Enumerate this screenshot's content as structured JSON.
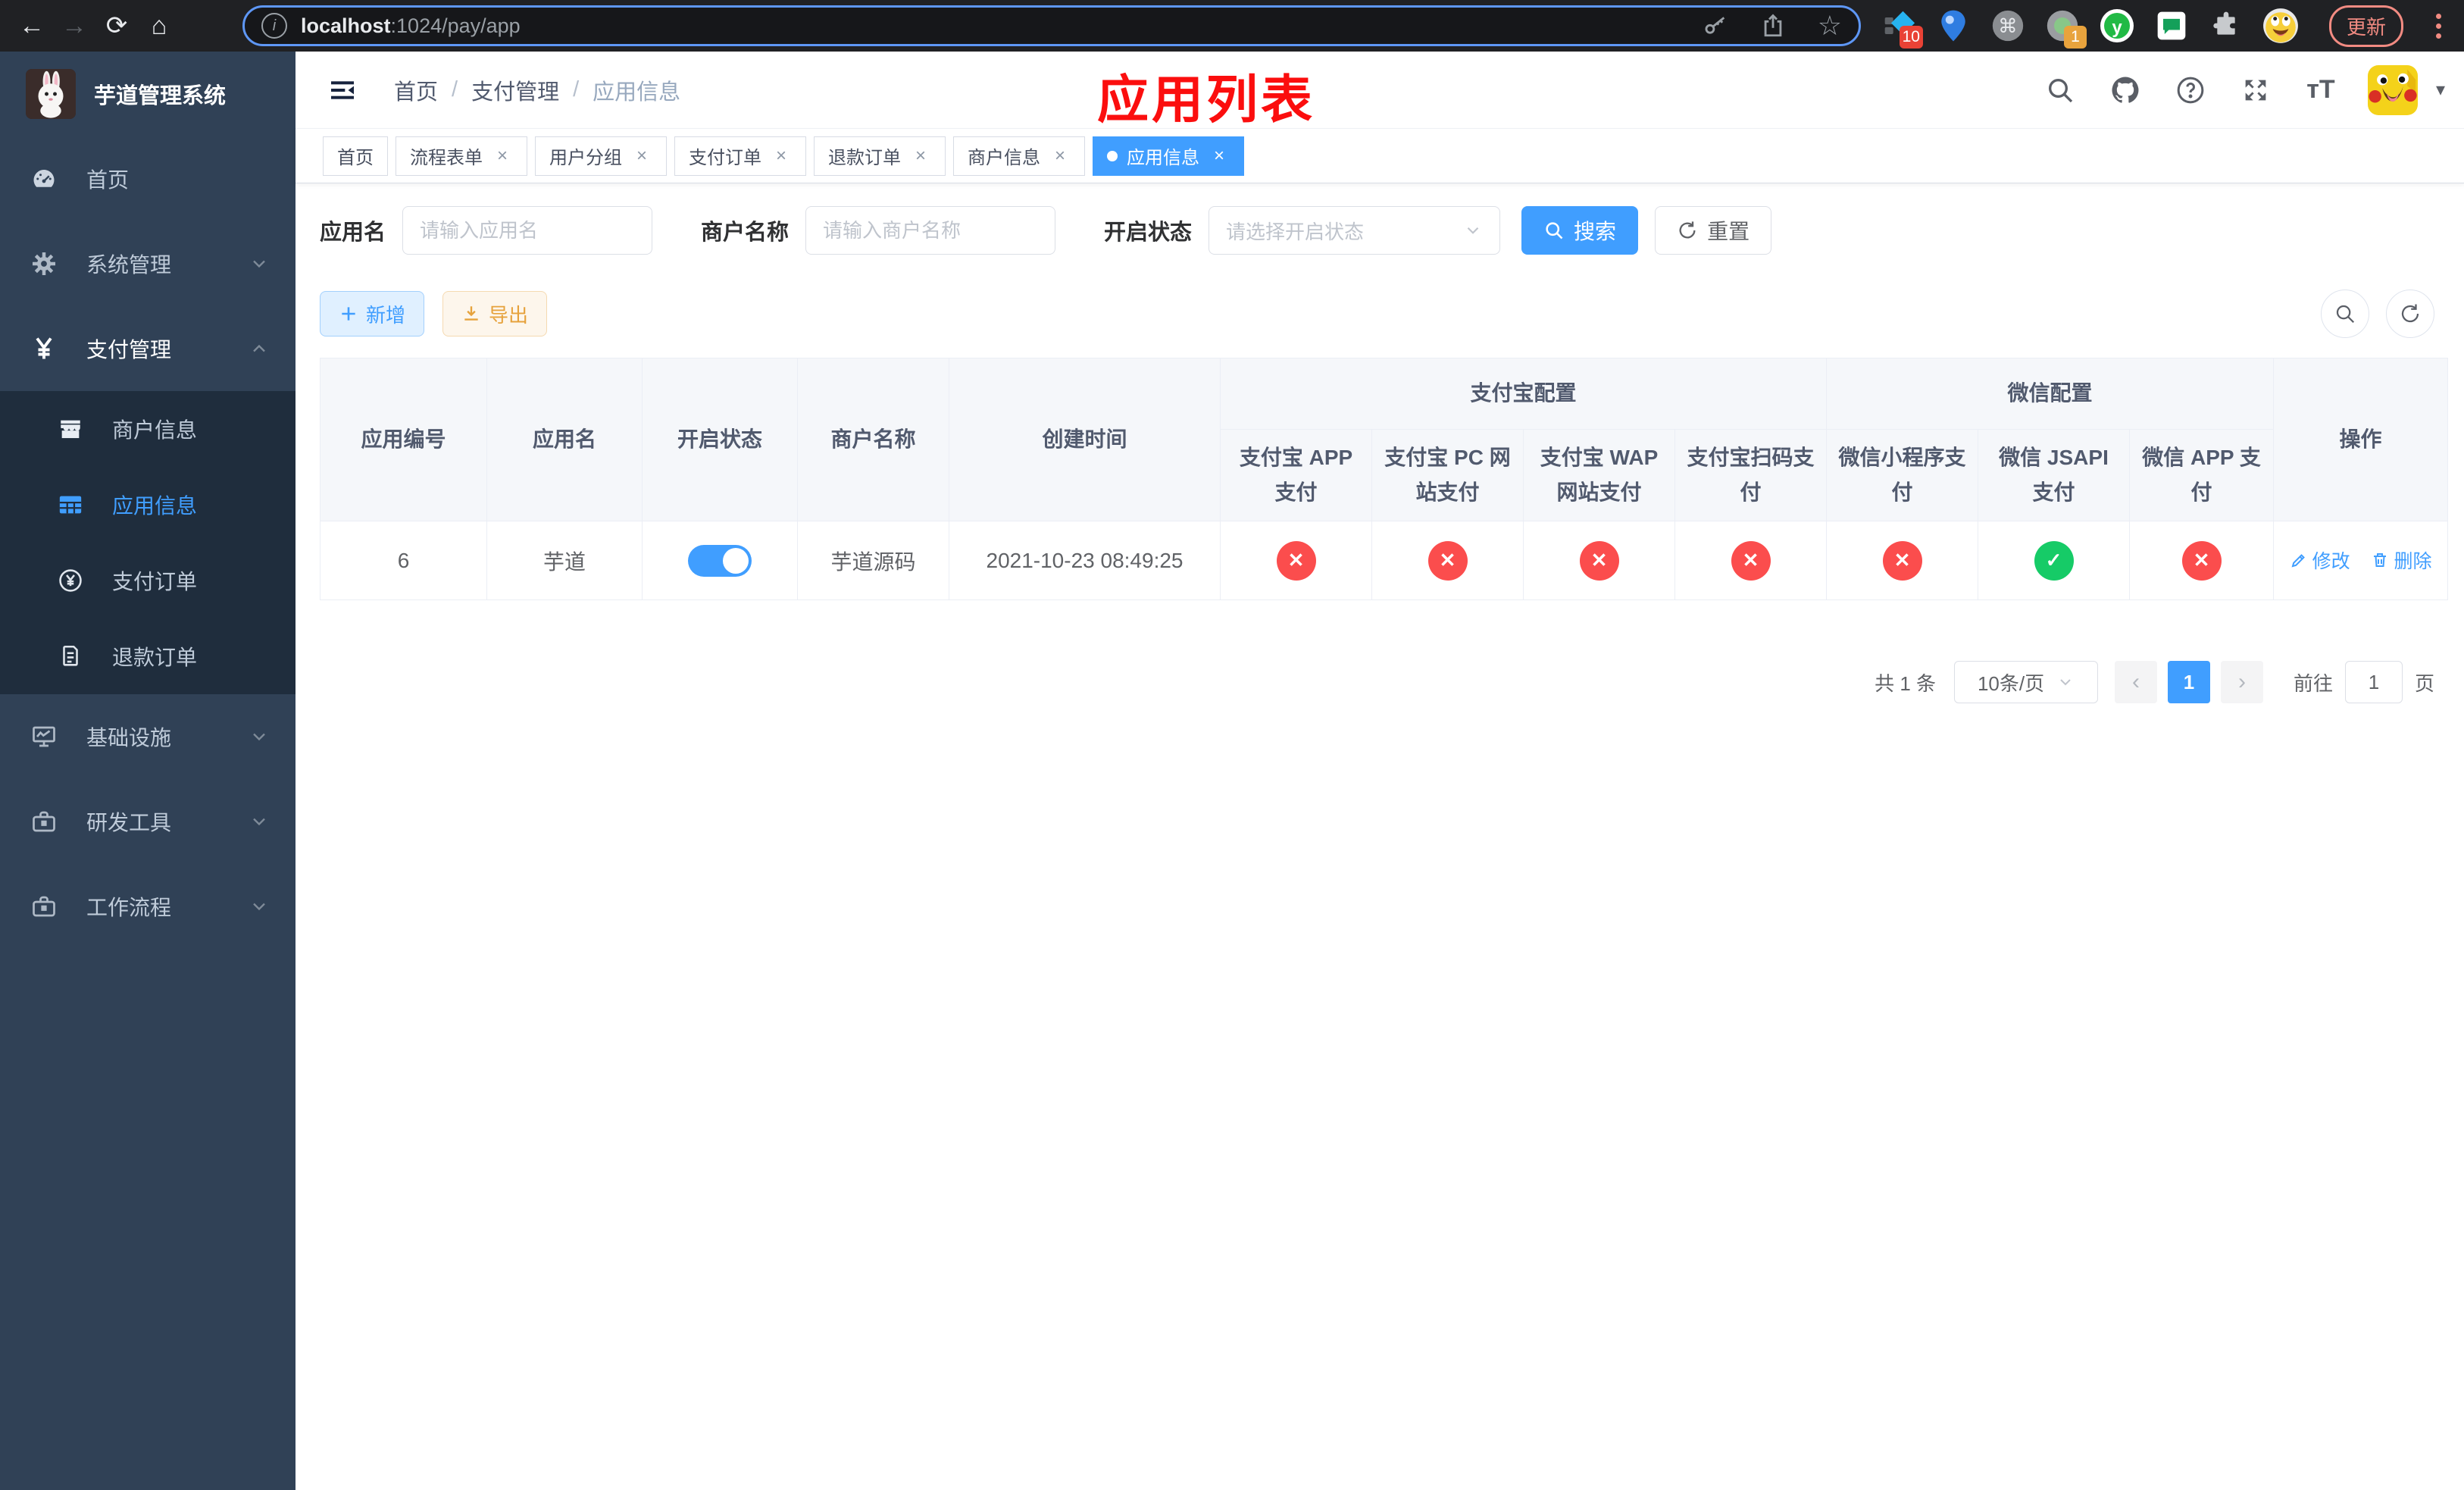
{
  "browser": {
    "url": {
      "host": "localhost",
      "path": ":1024/pay/app"
    },
    "ext_diamond_badge": "10",
    "ext_record_badge": "1",
    "ext_y_label": "y",
    "update_button": "更新"
  },
  "sidebar": {
    "title": "芋道管理系统",
    "menu": [
      {
        "label": "首页"
      },
      {
        "label": "系统管理"
      },
      {
        "label": "支付管理"
      },
      {
        "label": "商户信息"
      },
      {
        "label": "应用信息"
      },
      {
        "label": "支付订单"
      },
      {
        "label": "退款订单"
      },
      {
        "label": "基础设施"
      },
      {
        "label": "研发工具"
      },
      {
        "label": "工作流程"
      }
    ]
  },
  "navbar": {
    "breadcrumb": {
      "home": "首页",
      "separator": "/",
      "section": "支付管理",
      "current": "应用信息"
    },
    "annotation": "应用列表"
  },
  "tags": {
    "items": [
      {
        "label": "首页"
      },
      {
        "label": "流程表单"
      },
      {
        "label": "用户分组"
      },
      {
        "label": "支付订单"
      },
      {
        "label": "退款订单"
      },
      {
        "label": "商户信息"
      },
      {
        "label": "应用信息"
      }
    ]
  },
  "filters": {
    "app_name": {
      "label": "应用名",
      "placeholder": "请输入应用名"
    },
    "merchant": {
      "label": "商户名称",
      "placeholder": "请输入商户名称"
    },
    "status": {
      "label": "开启状态",
      "placeholder": "请选择开启状态"
    },
    "search_button": "搜索",
    "reset_button": "重置"
  },
  "toolbar": {
    "add_button": "新增",
    "export_button": "导出"
  },
  "table": {
    "headers": {
      "app_id": "应用编号",
      "app_name": "应用名",
      "status": "开启状态",
      "merchant": "商户名称",
      "created": "创建时间",
      "alipay_group": "支付宝配置",
      "wechat_group": "微信配置",
      "alipay_app": "支付宝 APP 支付",
      "alipay_pc": "支付宝 PC 网站支付",
      "alipay_wap": "支付宝 WAP 网站支付",
      "alipay_qr": "支付宝扫码支付",
      "wechat_mini": "微信小程序支付",
      "wechat_jsapi": "微信 JSAPI 支付",
      "wechat_app": "微信 APP 支付",
      "actions": "操作"
    },
    "row": {
      "app_id": "6",
      "app_name": "芋道",
      "status_on": true,
      "merchant": "芋道源码",
      "created": "2021-10-23 08:49:25",
      "pay_status": [
        "✕",
        "✕",
        "✕",
        "✕",
        "✕",
        "✓",
        "✕"
      ],
      "edit": "修改",
      "delete": "删除"
    }
  },
  "pagination": {
    "total": "共 1 条",
    "page_size": "10条/页",
    "page": "1",
    "goto_label": "前往",
    "goto_value": "1",
    "goto_suffix": "页"
  },
  "icons": {
    "close": "×",
    "prev": "‹",
    "next": "›",
    "caret_down": "▾",
    "star": "☆",
    "info": "i",
    "command": "⌘",
    "font_size": "тT",
    "back": "←",
    "forward": "→",
    "reload": "⟳",
    "home": "⌂"
  },
  "colors": {
    "accent": "#409EFF",
    "success": "#16cb67",
    "danger": "#fb4d4d",
    "warning": "#e6a23c",
    "sidebar_bg": "#304156",
    "submenu_bg": "#1f2d3d",
    "annotation": "#fb0e0e"
  }
}
